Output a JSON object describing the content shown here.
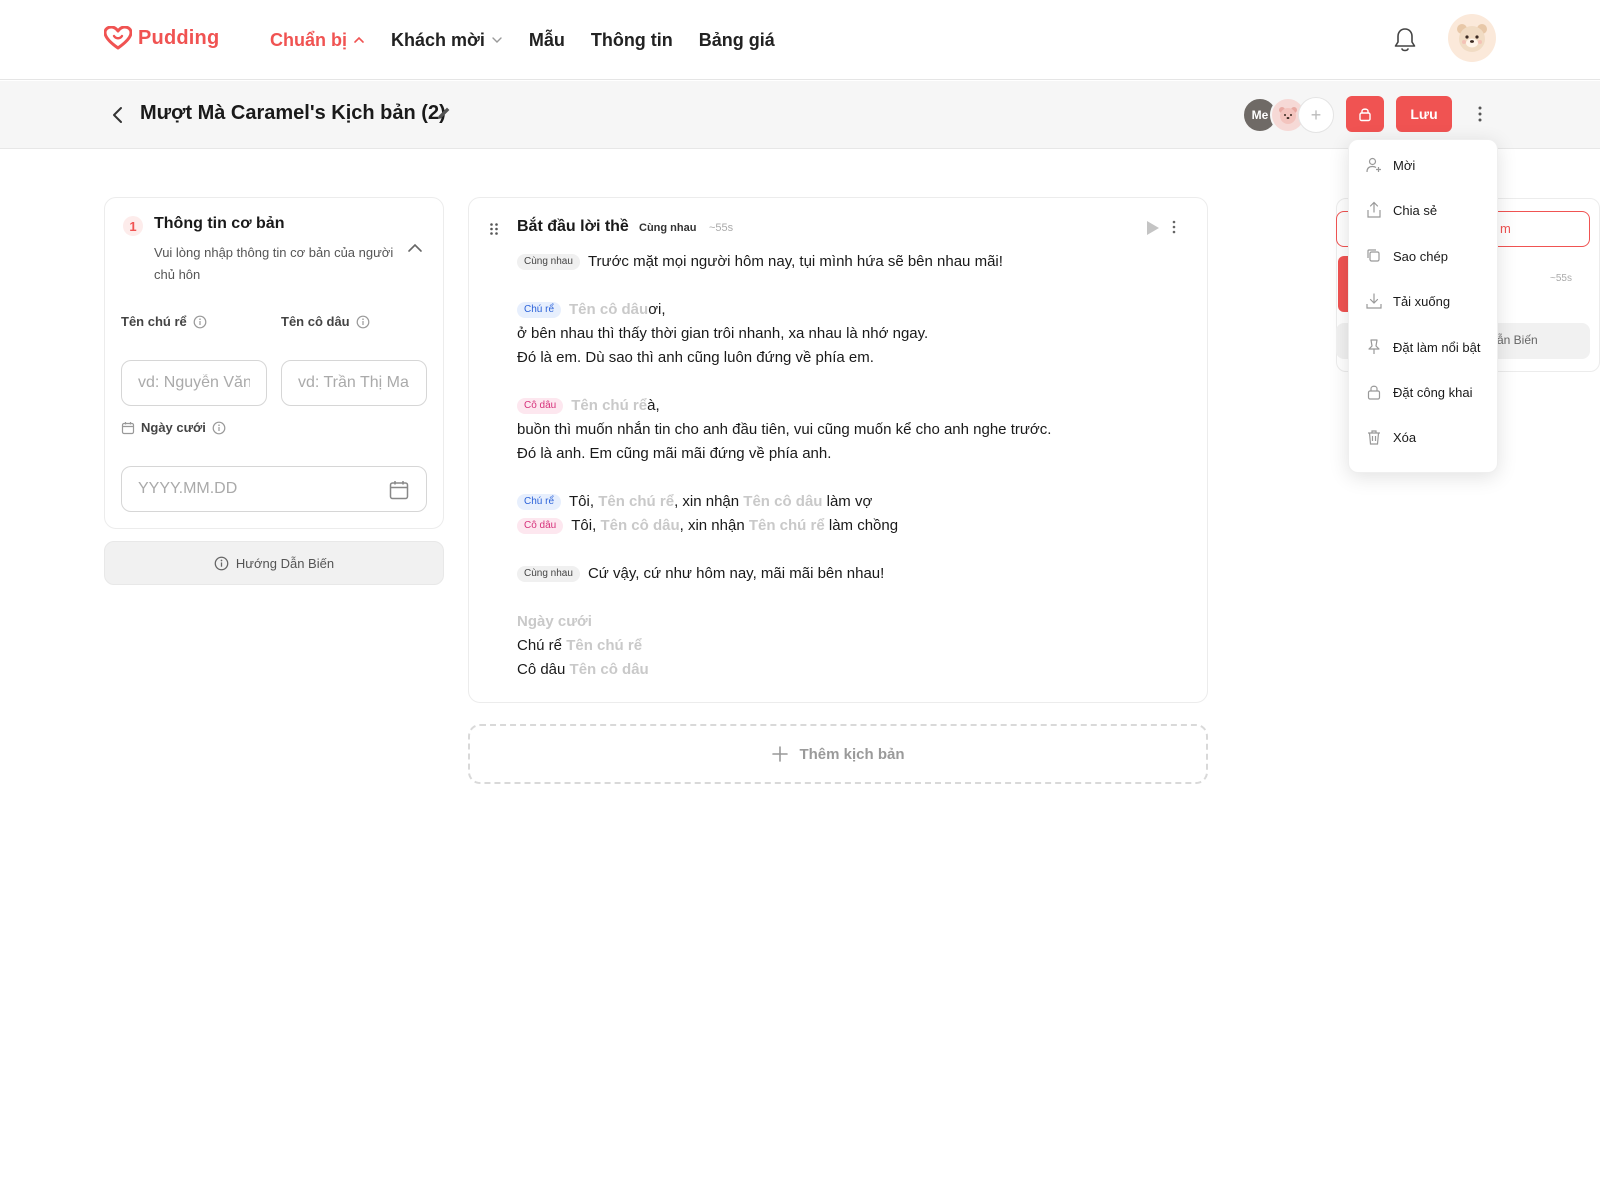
{
  "brand": {
    "name": "Pudding",
    "accent": "#f05352"
  },
  "nav": {
    "items": [
      {
        "label": "Chuẩn bị",
        "active": true,
        "has_chevron": true
      },
      {
        "label": "Khách mời",
        "active": false,
        "has_chevron": true
      },
      {
        "label": "Mẫu",
        "active": false,
        "has_chevron": false
      },
      {
        "label": "Thông tin",
        "active": false,
        "has_chevron": false
      },
      {
        "label": "Bảng giá",
        "active": false,
        "has_chevron": false
      }
    ]
  },
  "header": {
    "title": "Mượt Mà Caramel's Kịch bản (2)",
    "collaborator_me": "Me",
    "add_collaborator": "+",
    "save_label": "Lưu"
  },
  "basic_info": {
    "step": "1",
    "title": "Thông tin cơ bản",
    "subtitle": "Vui lòng nhập thông tin cơ bản của người chủ hôn",
    "groom_label": "Tên chú rể",
    "groom_placeholder": "vd: Nguyễn Văn",
    "bride_label": "Tên cô dâu",
    "bride_placeholder": "vd: Trần Thị Ma",
    "date_label": "Ngày cưới",
    "date_placeholder": "YYYY.MM.DD",
    "guide_label": "Hướng Dẫn Biến"
  },
  "script": {
    "title": "Bắt đầu lời thề",
    "title_tag": "Cùng nhau",
    "duration": "~55s",
    "tags": {
      "together": "Cùng nhau",
      "groom": "Chú rể",
      "bride": "Cô dâu"
    },
    "vars": {
      "groom": "Tên chú rể",
      "bride": "Tên cô dâu",
      "date": "Ngày cưới"
    },
    "text": {
      "l1": "Trước mặt mọi người hôm nay, tụi mình hứa sẽ bên nhau mãi!",
      "l2_suffix": " ơi,",
      "l3": "ở bên nhau thì thấy thời gian trôi nhanh, xa nhau là nhớ ngay.",
      "l4": "Đó là em. Dù sao thì anh cũng luôn đứng về phía em.",
      "l5_suffix": " à,",
      "l6": "buồn thì muốn nhắn tin cho anh đầu tiên, vui cũng muốn kể cho anh nghe trước.",
      "l7": "Đó là anh. Em cũng mãi mãi đứng về phía anh.",
      "toi": "Tôi, ",
      "xin_nhan": ", xin nhận ",
      "lam_vo": " làm vợ",
      "lam_chong": " làm chồng",
      "l10": "Cứ vậy, cứ như hôm nay, mãi mãi bên nhau!",
      "sig_groom": "Chú rể ",
      "sig_bride": "Cô dâu "
    }
  },
  "add_script_label": "Thêm kịch bản",
  "side_panel": {
    "outline_text": "m",
    "duration": "~55s",
    "guide_text": "ẫn Biến"
  },
  "dropdown": {
    "items": [
      {
        "label": "Mời",
        "icon": "user-plus-icon"
      },
      {
        "label": "Chia sẻ",
        "icon": "share-icon"
      },
      {
        "label": "Sao chép",
        "icon": "copy-icon"
      },
      {
        "label": "Tải xuống",
        "icon": "download-icon"
      },
      {
        "label": "Đặt làm nổi bật",
        "icon": "pin-icon"
      },
      {
        "label": "Đặt công khai",
        "icon": "lock-icon"
      },
      {
        "label": "Xóa",
        "icon": "trash-icon"
      }
    ]
  }
}
